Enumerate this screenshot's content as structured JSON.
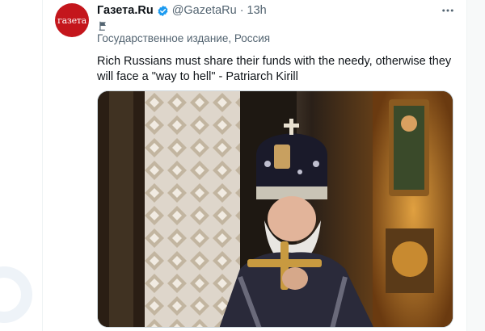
{
  "account": {
    "display_name": "Газета.Ru",
    "handle": "@GazetaRu",
    "separator": "·",
    "time": "13h",
    "avatar_text": "газета",
    "affiliation": "Государственное издание, Россия"
  },
  "tweet": {
    "text": "Rich Russians must share their funds with the needy, otherwise they will face a \"way to hell\" - Patriarch Kirill"
  },
  "icons": {
    "verified": "verified-badge-icon",
    "more": "more-options-icon",
    "label": "state-media-flag-icon"
  },
  "colors": {
    "accent": "#1d9bf0",
    "avatar_bg": "#c4161c",
    "secondary_text": "#536471"
  }
}
